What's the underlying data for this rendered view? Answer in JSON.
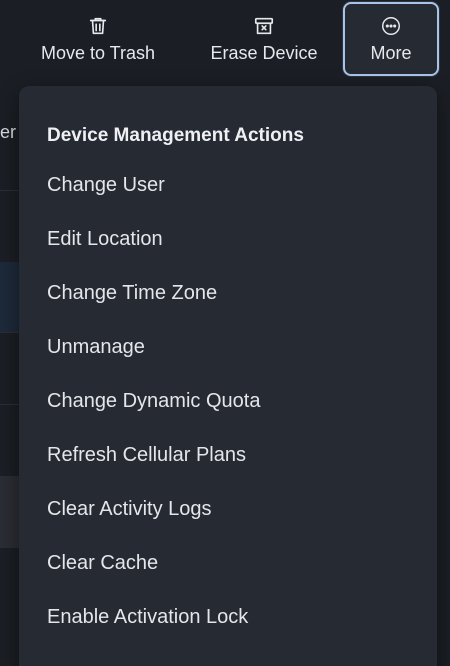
{
  "toolbar": {
    "move_to_trash": {
      "label": "Move to Trash",
      "icon": "trash-icon"
    },
    "erase_device": {
      "label": "Erase Device",
      "icon": "erase-box-icon"
    },
    "more": {
      "label": "More",
      "icon": "ellipsis-circle-icon"
    }
  },
  "background": {
    "cut_text": "er"
  },
  "dropdown": {
    "header": "Device Management Actions",
    "items": [
      "Change User",
      "Edit Location",
      "Change Time Zone",
      "Unmanage",
      "Change Dynamic Quota",
      "Refresh Cellular Plans",
      "Clear Activity Logs",
      "Clear Cache",
      "Enable Activation Lock"
    ]
  },
  "colors": {
    "background": "#1b1e24",
    "dropdown_bg": "#262a33",
    "focus_ring": "#a9c4e6",
    "text": "#e6e8ec"
  }
}
